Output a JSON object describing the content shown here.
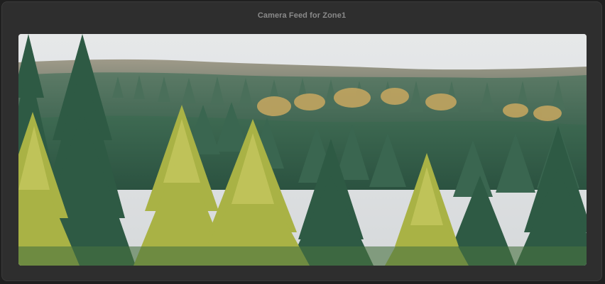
{
  "window": {
    "title": "Camera Feed for Zone1"
  },
  "feed": {
    "zone": "Zone1",
    "scene_icon": "forest-landscape-image"
  },
  "colors": {
    "panel_background": "#2e2e2e",
    "page_background": "#1f1f1f",
    "title_text": "#8a8a8a",
    "sky": "#dcdfe1",
    "distant_hills": "#8d8a7a",
    "dark_conifer": "#2f5a44",
    "mid_conifer": "#3f6d52",
    "larch_yellow": "#a9b245",
    "larch_light": "#c2c25a"
  }
}
